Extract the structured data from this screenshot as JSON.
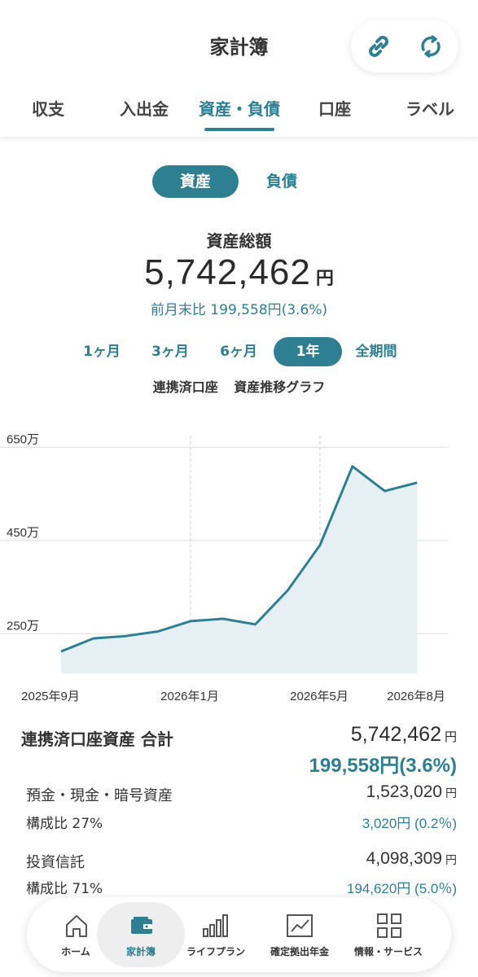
{
  "header": {
    "title": "家計簿",
    "actions": [
      {
        "icon": "link-icon"
      },
      {
        "icon": "sync-icon"
      }
    ]
  },
  "tabs": [
    "収支",
    "入出金",
    "資産・負債",
    "口座",
    "ラベル"
  ],
  "active_tab": "資産・負債",
  "toggle": {
    "asset": "資産",
    "liability": "負債",
    "active": "資産"
  },
  "total": {
    "label": "資産総額",
    "value": "5,742,462",
    "unit": "円",
    "diff": "前月末比 199,558円(3.6%)"
  },
  "periods": [
    "1ヶ月",
    "3ヶ月",
    "6ヶ月",
    "1年",
    "全期間"
  ],
  "active_period": "1年",
  "chart_caption": "連携済口座 資産推移グラフ",
  "chart_data": {
    "type": "area",
    "x_labels": [
      "2025年9月",
      "2026年1月",
      "2026年5月",
      "2026年8月"
    ],
    "y_ticks": [
      "650万",
      "450万",
      "250万"
    ],
    "y_tick_values": [
      650,
      450,
      250
    ],
    "ylim": [
      165,
      675
    ],
    "unit": "万円",
    "x": [
      "2025-08",
      "2025-09",
      "2025-10",
      "2025-11",
      "2025-12",
      "2026-01",
      "2026-02",
      "2026-03",
      "2026-04",
      "2026-05",
      "2026-06",
      "2026-07",
      "2026-08"
    ],
    "values": [
      212,
      240,
      245,
      255,
      277,
      282,
      270,
      343,
      440,
      609,
      556,
      574,
      574
    ],
    "grid": true,
    "color": "#2f7f92",
    "fill": "#e6f0f4"
  },
  "summary": {
    "label": "連携済口座資産 合計",
    "value": "5,742,462",
    "unit": "円",
    "diff": "199,558円(3.6%)"
  },
  "rows": [
    {
      "label": "預金・現金・暗号資産",
      "sub": "構成比 27%",
      "value": "1,523,020",
      "unit": "円",
      "diff": "3,020円 (0.2％)"
    },
    {
      "label": "投資信託",
      "sub": "構成比 71%",
      "value": "4,098,309",
      "unit": "円",
      "diff": "194,620円 (5.0％)"
    }
  ],
  "bottom_nav": [
    {
      "label": "ホーム",
      "icon": "home-icon"
    },
    {
      "label": "家計簿",
      "icon": "wallet-icon"
    },
    {
      "label": "ライフプラン",
      "icon": "bar-chart-icon"
    },
    {
      "label": "確定拠出年金",
      "icon": "line-chart-icon"
    },
    {
      "label": "情報・サービス",
      "icon": "grid-icon"
    }
  ],
  "active_nav": "家計簿",
  "colors": {
    "accent": "#2f7f92",
    "text": "#2b2b2b"
  }
}
